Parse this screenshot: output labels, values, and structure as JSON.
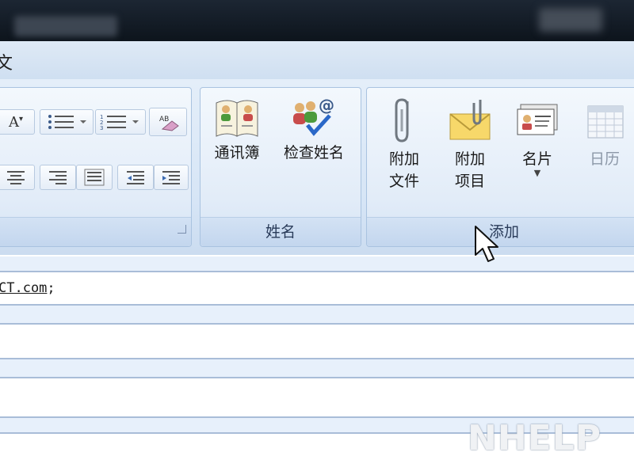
{
  "window": {
    "title_fragment": "文"
  },
  "ribbon": {
    "names_group": {
      "label": "姓名",
      "address_book": "通讯簿",
      "check_names": "检查姓名"
    },
    "include_group": {
      "label": "添加",
      "attach_file": [
        "附加",
        "文件"
      ],
      "attach_item": [
        "附加",
        "项目"
      ],
      "business_card": "名片",
      "calendar": "日历"
    }
  },
  "message": {
    "to_value_underlined": "CT.com",
    "to_value_suffix": ";"
  },
  "watermark": "NHELP",
  "colors": {
    "ribbon_bg": "#d6e5f6",
    "group_border": "#a9c3e0",
    "chrome_dark": "#111922"
  }
}
